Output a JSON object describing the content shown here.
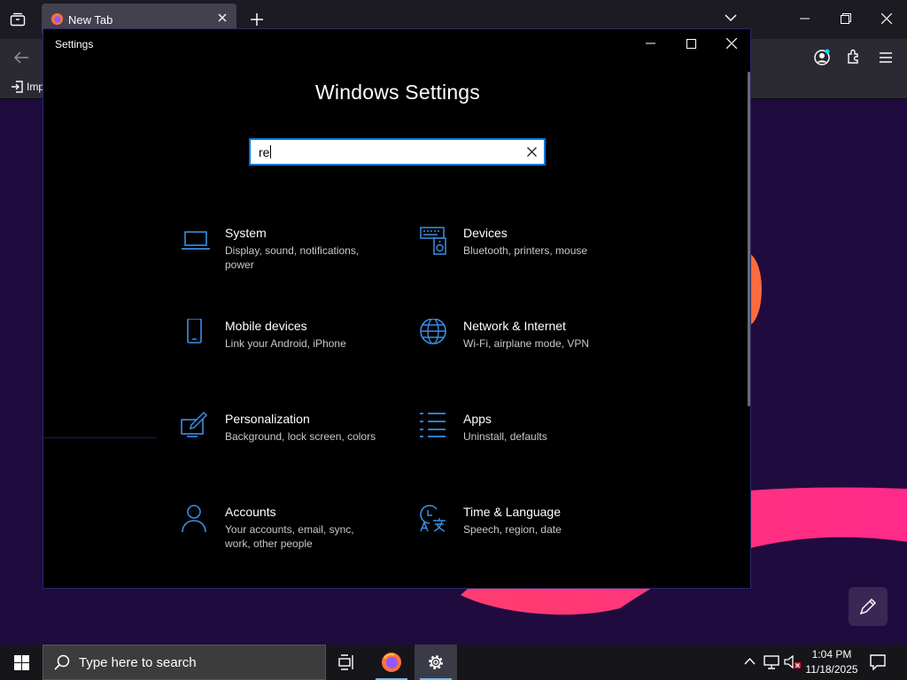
{
  "browser": {
    "tab_title": "New Tab",
    "bookmark_label": "Imp"
  },
  "settings": {
    "window_title": "Settings",
    "heading": "Windows Settings",
    "search_value": "re",
    "categories": [
      {
        "name": "System",
        "desc": "Display, sound, notifications, power",
        "icon": "laptop-icon"
      },
      {
        "name": "Devices",
        "desc": "Bluetooth, printers, mouse",
        "icon": "keyboard-speaker-icon"
      },
      {
        "name": "Mobile devices",
        "desc": "Link your Android, iPhone",
        "icon": "phone-icon"
      },
      {
        "name": "Network & Internet",
        "desc": "Wi-Fi, airplane mode, VPN",
        "icon": "globe-icon"
      },
      {
        "name": "Personalization",
        "desc": "Background, lock screen, colors",
        "icon": "paint-screen-icon"
      },
      {
        "name": "Apps",
        "desc": "Uninstall, defaults",
        "icon": "list-icon"
      },
      {
        "name": "Accounts",
        "desc": "Your accounts, email, sync, work, other people",
        "icon": "person-icon"
      },
      {
        "name": "Time & Language",
        "desc": "Speech, region, date",
        "icon": "clock-language-icon"
      }
    ]
  },
  "taskbar": {
    "search_placeholder": "Type here to search",
    "time": "1:04 PM",
    "date": "11/18/2025"
  },
  "colors": {
    "accent": "#0078d7",
    "icon_blue": "#3a8ee6",
    "wallpaper": "#200b3e"
  }
}
